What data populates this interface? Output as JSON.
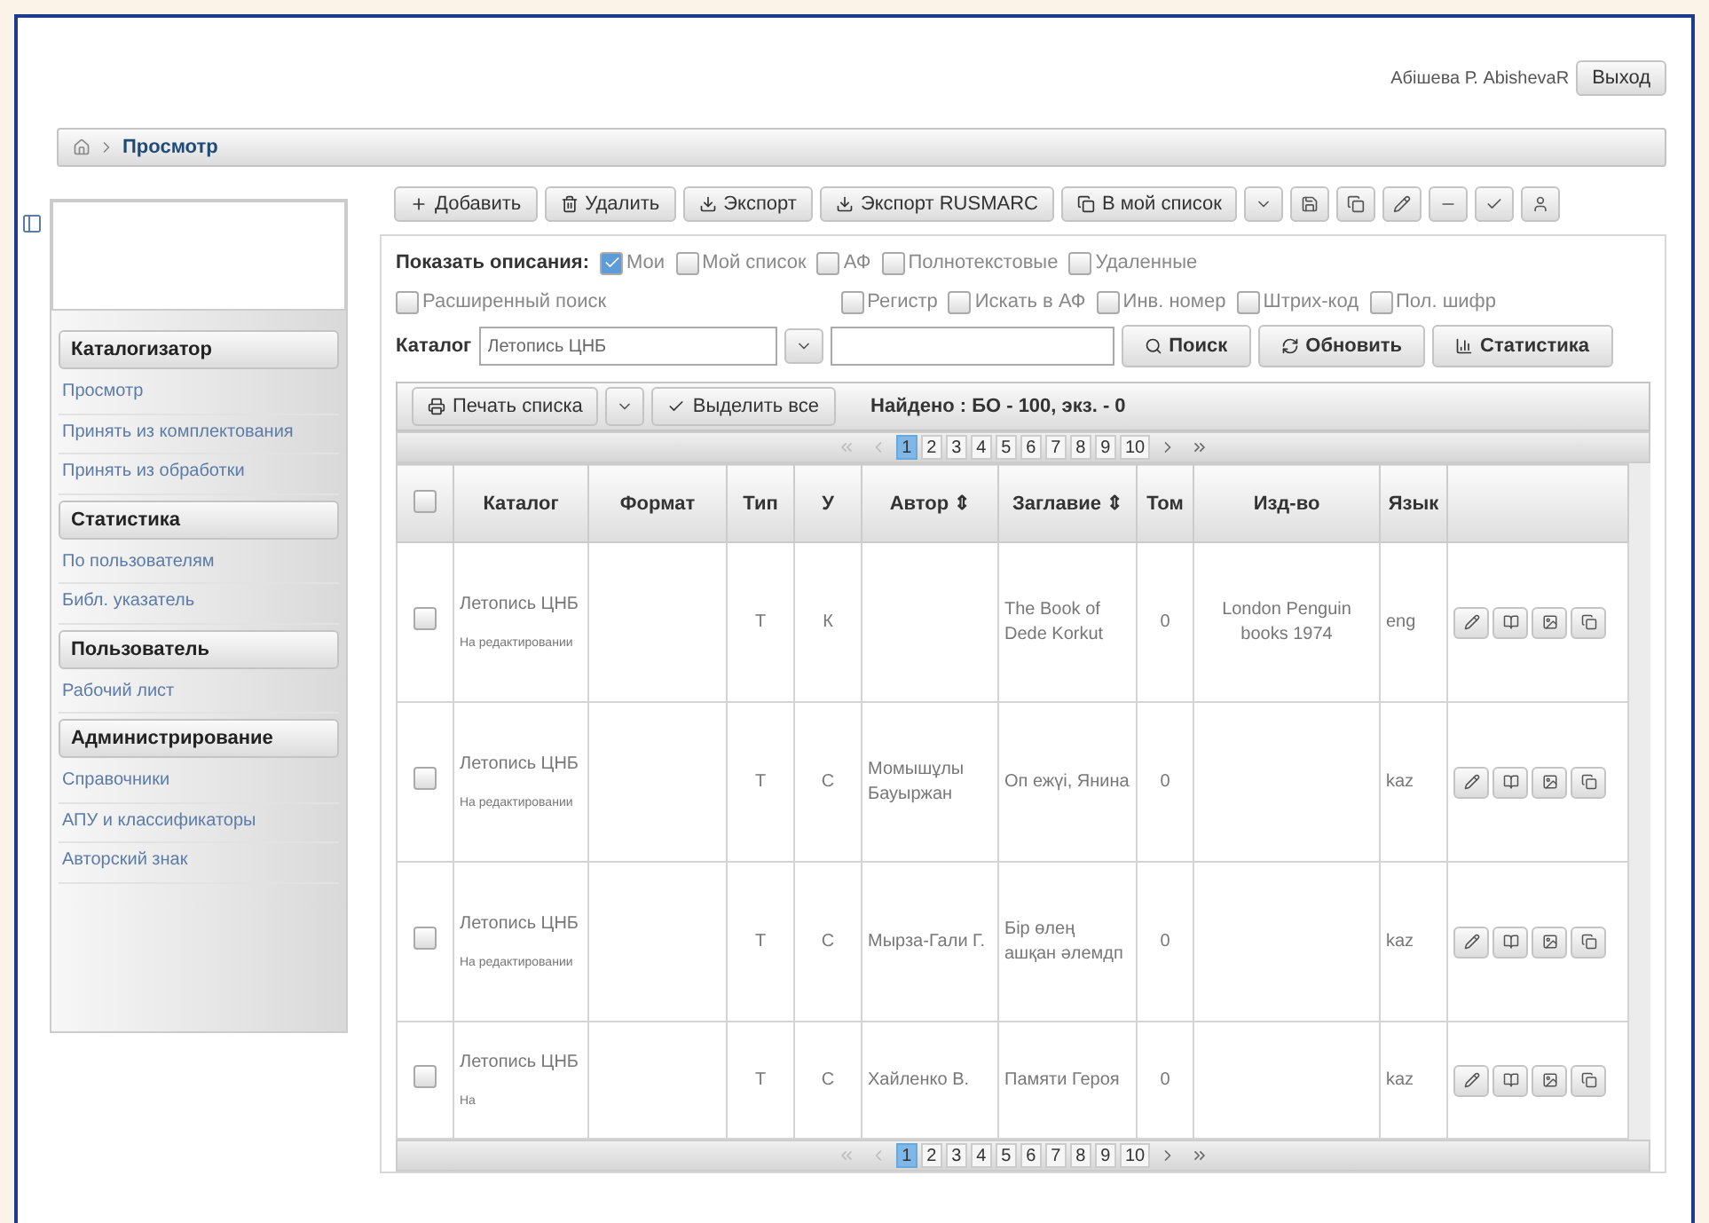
{
  "user": {
    "name": "Абішева Р. AbishevaR",
    "logout": "Выход"
  },
  "breadcrumb": {
    "current": "Просмотр"
  },
  "sidebar": [
    {
      "title": "Каталогизатор",
      "items": [
        "Просмотр",
        "Принять из комплектования",
        "Принять из обработки"
      ]
    },
    {
      "title": "Статистика",
      "items": [
        "По пользователям",
        "Библ. указатель"
      ]
    },
    {
      "title": "Пользователь",
      "items": [
        "Рабочий лист"
      ]
    },
    {
      "title": "Администрирование",
      "items": [
        "Справочники",
        "АПУ и классификаторы",
        "Авторский знак"
      ]
    }
  ],
  "toolbar": [
    {
      "kind": "text",
      "label": "Добавить"
    },
    {
      "kind": "text",
      "label": "Удалить"
    },
    {
      "kind": "text",
      "label": "Экспорт"
    },
    {
      "kind": "text",
      "label": "Экспорт RUSMARC"
    },
    {
      "kind": "text",
      "label": "В мой список"
    },
    {
      "kind": "icon"
    },
    {
      "kind": "icon"
    },
    {
      "kind": "icon"
    },
    {
      "kind": "icon"
    },
    {
      "kind": "icon"
    },
    {
      "kind": "icon"
    },
    {
      "kind": "icon"
    }
  ],
  "filters": {
    "label": "Показать описания:",
    "row1": [
      {
        "label": "Мои",
        "checked": true
      },
      {
        "label": "Мой список",
        "checked": false
      },
      {
        "label": "АФ",
        "checked": false
      },
      {
        "label": "Полнотекстовые",
        "checked": false
      },
      {
        "label": "Удаленные",
        "checked": false
      }
    ],
    "row2_left": [
      {
        "label": "Расширенный поиск",
        "checked": false
      }
    ],
    "row2_right": [
      {
        "label": "Регистр",
        "checked": false
      },
      {
        "label": "Искать в АФ",
        "checked": false
      },
      {
        "label": "Инв. номер",
        "checked": false
      },
      {
        "label": "Штрих-код",
        "checked": false
      },
      {
        "label": "Пол. шифр",
        "checked": false
      }
    ]
  },
  "search": {
    "catalog_label": "Каталог",
    "catalog_value": "Летопись ЦНБ",
    "buttons": [
      {
        "label": "Поиск"
      },
      {
        "label": "Обновить"
      },
      {
        "label": "Статистика"
      }
    ]
  },
  "list_toolbar": {
    "print": "Печать списка",
    "select_all": "Выделить все",
    "found": "Найдено : БО - 100, экз. - 0"
  },
  "pager": {
    "pages": [
      {
        "label": "1",
        "selected": true
      },
      {
        "label": "2",
        "selected": false
      },
      {
        "label": "3",
        "selected": false
      },
      {
        "label": "4",
        "selected": false
      },
      {
        "label": "5",
        "selected": false
      },
      {
        "label": "6",
        "selected": false
      },
      {
        "label": "7",
        "selected": false
      },
      {
        "label": "8",
        "selected": false
      },
      {
        "label": "9",
        "selected": false
      },
      {
        "label": "10",
        "selected": false
      }
    ]
  },
  "pager_bottom": {
    "pages": [
      {
        "label": "1",
        "selected": true
      },
      {
        "label": "2",
        "selected": false
      },
      {
        "label": "3",
        "selected": false
      },
      {
        "label": "4",
        "selected": false
      },
      {
        "label": "5",
        "selected": false
      },
      {
        "label": "6",
        "selected": false
      },
      {
        "label": "7",
        "selected": false
      },
      {
        "label": "8",
        "selected": false
      },
      {
        "label": "9",
        "selected": false
      },
      {
        "label": "10",
        "selected": false
      }
    ]
  },
  "table": {
    "header_checked": false,
    "columns": [
      "Каталог",
      "Формат",
      "Тип",
      "У",
      "Автор ⇕",
      "Заглавие ⇕",
      "Том",
      "Изд-во",
      "Язык"
    ],
    "rows": [
      {
        "checked": false,
        "catalog": "Летопись ЦНБ",
        "status": "На редактировании",
        "format": "",
        "type": "Т",
        "u": "К",
        "author": "",
        "title": "The Book of Dede Korkut",
        "volume": "0",
        "publisher": "London Penguin books 1974",
        "language": "eng"
      },
      {
        "checked": false,
        "catalog": "Летопись ЦНБ",
        "status": "На редактировании",
        "format": "",
        "type": "Т",
        "u": "С",
        "author": "Момышұлы Бауыржан",
        "title": "Оп ежүі, Янина",
        "volume": "0",
        "publisher": "",
        "language": "kaz"
      },
      {
        "checked": false,
        "catalog": "Летопись ЦНБ",
        "status": "На редактировании",
        "format": "",
        "type": "Т",
        "u": "С",
        "author": "Мырза-Гали Г.",
        "title": "Бір өлең ашқан әлемдп",
        "volume": "0",
        "publisher": "",
        "language": "kaz"
      },
      {
        "checked": false,
        "catalog": "Летопись ЦНБ",
        "status": "На",
        "format": "",
        "type": "Т",
        "u": "С",
        "author": "Хайленко В.",
        "title": "Памяти Героя",
        "volume": "0",
        "publisher": "",
        "language": "kaz"
      }
    ]
  }
}
